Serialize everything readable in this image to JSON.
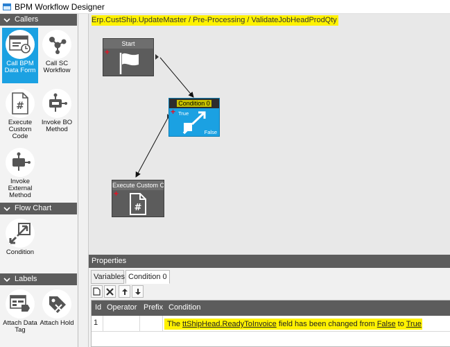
{
  "window": {
    "title": "BPM Workflow Designer"
  },
  "toolbox": {
    "sections": [
      {
        "label": "Callers"
      },
      {
        "label": "Flow Chart"
      },
      {
        "label": "Labels"
      }
    ],
    "callers": [
      {
        "label": "Call BPM Data Form",
        "icon": "data-form-icon",
        "selected": true
      },
      {
        "label": "Call SC Workflow",
        "icon": "workflow-icon"
      },
      {
        "label": "Execute Custom Code",
        "icon": "custom-code-icon"
      },
      {
        "label": "Invoke BO Method",
        "icon": "bo-method-icon"
      },
      {
        "label": "Invoke External Method",
        "icon": "external-method-icon"
      }
    ],
    "flowchart": [
      {
        "label": "Condition",
        "icon": "condition-icon"
      }
    ],
    "labels": [
      {
        "label": "Attach Data Tag",
        "icon": "data-tag-icon"
      },
      {
        "label": "Attach Hold",
        "icon": "hold-icon"
      }
    ]
  },
  "canvas": {
    "path": "Erp.CustShip.UpdateMaster / Pre-Processing / ValidateJobHeadProdQty",
    "nodes": {
      "start": {
        "title": "Start",
        "icon": "flag-icon"
      },
      "condition": {
        "title": "Condition 0",
        "true_label": "True",
        "false_label": "False",
        "icon": "condition-icon"
      },
      "custom_code": {
        "title": "Execute Custom Co",
        "icon": "custom-code-icon"
      }
    }
  },
  "properties": {
    "header": "Properties",
    "tabs": [
      {
        "label": "Variables",
        "active": false
      },
      {
        "label": "Condition 0",
        "active": true
      }
    ],
    "toolbar": [
      "new-icon",
      "delete-icon",
      "arrow-up-icon",
      "arrow-down-icon"
    ],
    "grid": {
      "columns": [
        "Id",
        "Operator",
        "Prefix",
        "Condition"
      ],
      "rows": [
        {
          "id": "1",
          "operator": "",
          "prefix": "",
          "condition": {
            "prefix": "The ",
            "field": "ttShipHead.ReadyToInvoice",
            "middle": " field has been changed from ",
            "from": "False",
            "to_word": " to ",
            "to": "True"
          }
        }
      ]
    }
  },
  "colors": {
    "accent": "#1ba1e2",
    "header_gray": "#5c5c5c",
    "highlight": "#fff200",
    "error_red": "#e81123"
  }
}
